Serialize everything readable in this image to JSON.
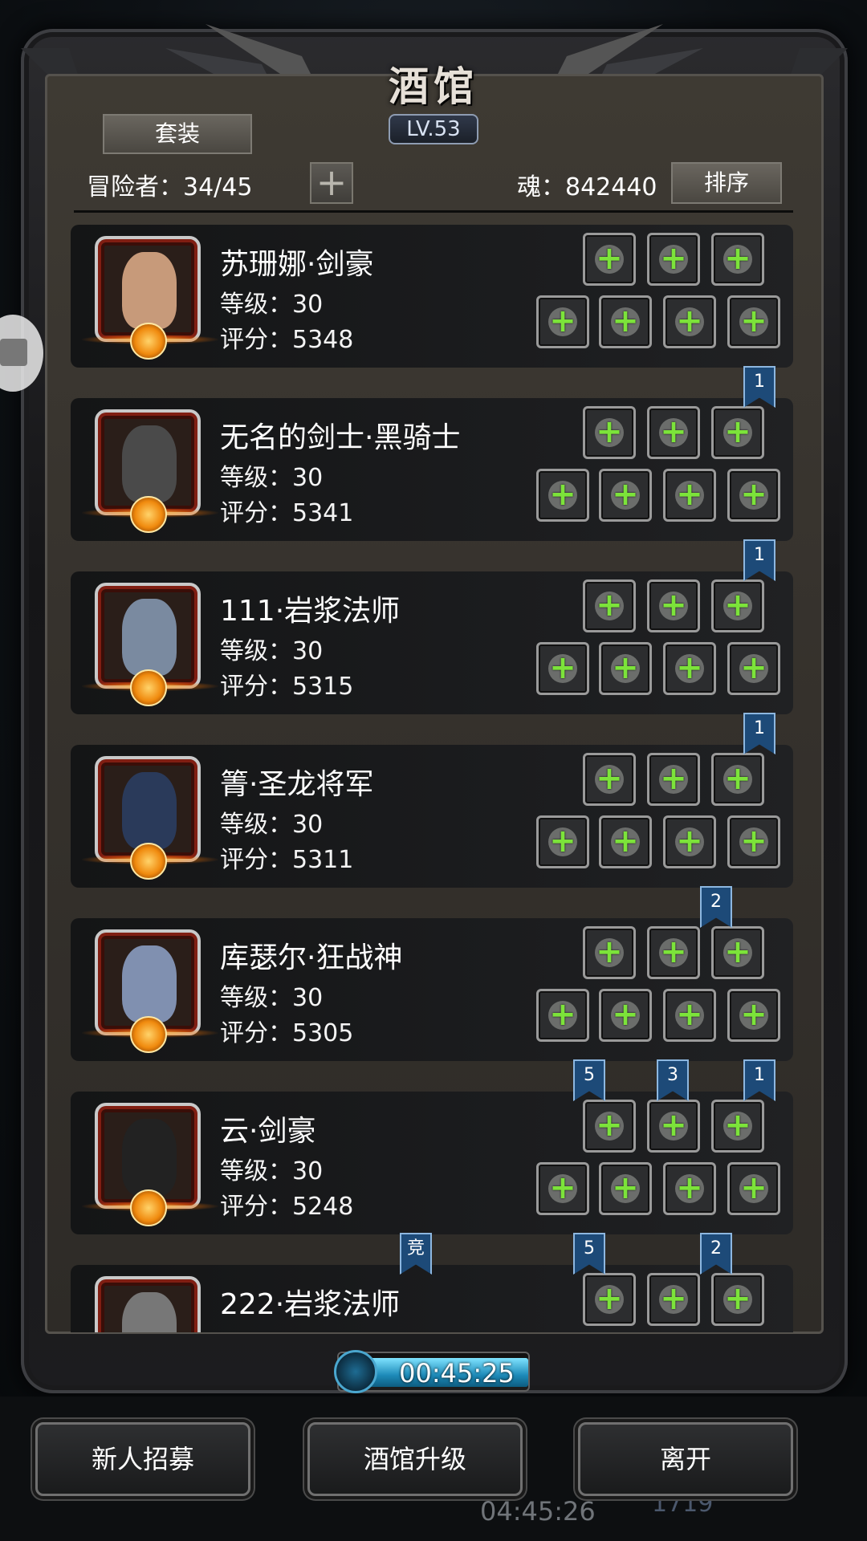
{
  "window": {
    "title": "酒馆",
    "level_badge": "LV.53"
  },
  "toolbar": {
    "set_tab_label": "套装",
    "adventurers_label": "冒险者：34/45",
    "add_symbol": "+",
    "soul_label": "魂：842440",
    "sort_label": "排序"
  },
  "cards": [
    {
      "name": "苏珊娜·剑豪",
      "level": "等级：30",
      "score": "评分：5348"
    },
    {
      "name": "无名的剑士·黑骑士",
      "level": "等级：30",
      "score": "评分：5341"
    },
    {
      "name": "111·岩浆法师",
      "level": "等级：30",
      "score": "评分：5315"
    },
    {
      "name": "箐·圣龙将军",
      "level": "等级：30",
      "score": "评分：5311"
    },
    {
      "name": "库瑟尔·狂战神",
      "level": "等级：30",
      "score": "评分：5305"
    },
    {
      "name": "云·剑豪",
      "level": "等级：30",
      "score": "评分：5248"
    },
    {
      "name": "222·岩浆法师",
      "level": "",
      "score": ""
    }
  ],
  "slot_plus": "+",
  "rank_tags": [
    "1",
    "1",
    "1",
    "2",
    "5",
    "3",
    "1",
    "竞",
    "5",
    "2"
  ],
  "timer": {
    "value": "00:45:25"
  },
  "bottom": {
    "recruit_label": "新人招募",
    "upgrade_label": "酒馆升级",
    "leave_label": "离开",
    "bg_time": "04:45:26",
    "bg_count": "1719"
  },
  "colors": {
    "plus_green": "#7ce33a",
    "rank_blue": "#1d4a78",
    "portrait_red": "#801e12"
  },
  "icons": {
    "slot_top": [
      "ring-slot-icon",
      "armor-slot-icon",
      "armor-slot-icon"
    ],
    "slot_bottom": [
      "weapon-slot-icon",
      "cloak-slot-icon",
      "accessory-slot-icon",
      "accessory-slot-icon"
    ]
  }
}
